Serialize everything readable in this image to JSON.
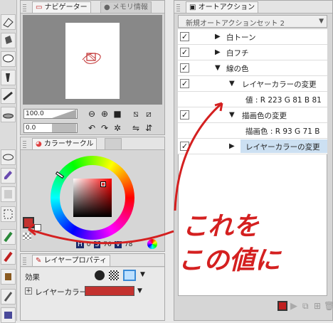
{
  "navigator": {
    "tab_label": "ナビゲーター",
    "memory_tab_label": "メモリ情報",
    "zoom_value": "100.0",
    "rotate_value": "0.0"
  },
  "color_circle": {
    "tab_label": "カラーサークル",
    "h_label": "H",
    "h_value": "0",
    "s_label": "S",
    "s_value": "76",
    "v_label": "V",
    "v_value": "78"
  },
  "layer_property": {
    "tab_label": "レイヤープロパティ",
    "effect_label": "効果",
    "layer_color_label": "レイヤーカラー",
    "layer_color_hex": "#c3322f"
  },
  "auto_action": {
    "tab_label": "オートアクション",
    "set_selector": "新規オートアクションセット 2",
    "rows": [
      {
        "label": "白トーン",
        "checked": true
      },
      {
        "label": "白フチ",
        "checked": true
      },
      {
        "label": "線の色",
        "checked": true
      },
      {
        "label": "レイヤーカラーの変更",
        "checked": true
      },
      {
        "label": "値 : R 223 G 81 B 81",
        "checked": false
      },
      {
        "label": "描画色の変更",
        "checked": true
      },
      {
        "label": "描画色 : R 93 G 71 B",
        "checked": false
      },
      {
        "label": "レイヤーカラーの変更",
        "checked": true
      }
    ]
  },
  "annotation": {
    "line1": "これを",
    "line2": "この値に",
    "color": "#d42020"
  },
  "colors": {
    "current_color": "#c3322f",
    "selection_blue": "#cce0f2"
  }
}
